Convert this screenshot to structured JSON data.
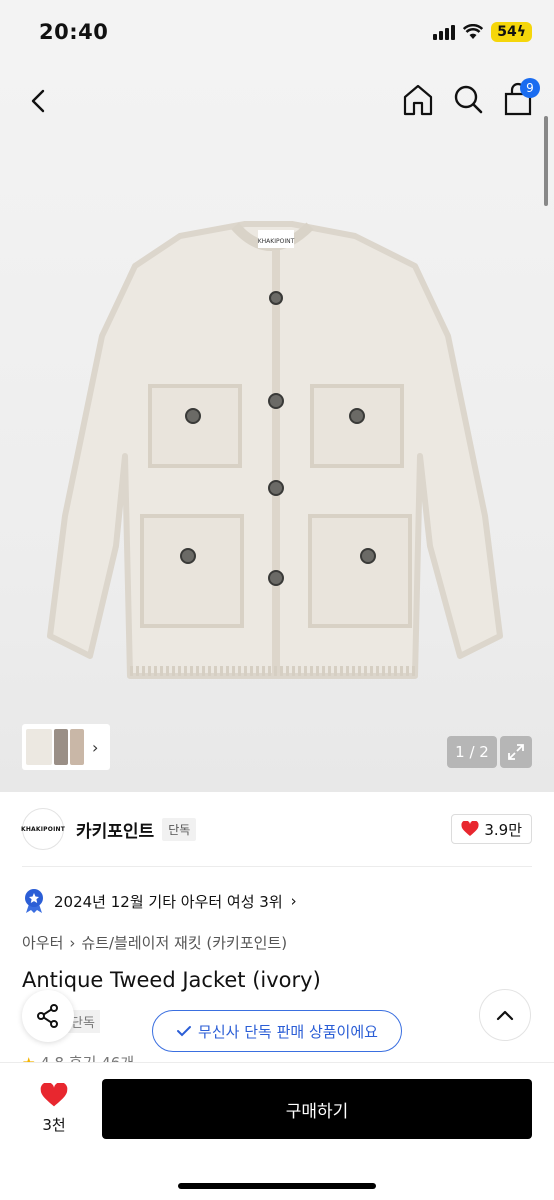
{
  "status_bar": {
    "time": "20:40",
    "battery": "54"
  },
  "top_nav": {
    "icons": [
      "chevron-left-icon",
      "home-icon",
      "search-icon",
      "cart-icon"
    ],
    "cart_count": "9"
  },
  "gallery": {
    "brand_label_on_jacket": "KHAKIPOINT",
    "counter": "1 / 2",
    "thumbnail_colors": [
      "#ece8e1",
      "#9a8f86",
      "#c9b7a7"
    ]
  },
  "brand": {
    "logo_text": "KHAKIPOINT",
    "name": "카키포인트",
    "tag": "단독",
    "likes": "3.9만"
  },
  "ranking": {
    "text": "2024년 12월 기타 아우터 여성 3위"
  },
  "breadcrumb": {
    "items": [
      "아우터",
      "슈트/블레이저 재킷 (카키포인트)"
    ]
  },
  "product": {
    "name": "Antique Tweed Jacket (ivory)",
    "partial_tag": "단독",
    "exclusive_text": "무신사 단독 판매 상품이에요",
    "rating": "4.8",
    "reviews": "후기 46개"
  },
  "bottom_bar": {
    "like_count": "3천",
    "buy_label": "구매하기"
  },
  "colors": {
    "accent_blue": "#1a6cf0",
    "heart_red": "#e8272f",
    "buy_black": "#000000",
    "battery_yellow": "#f5d60a"
  }
}
